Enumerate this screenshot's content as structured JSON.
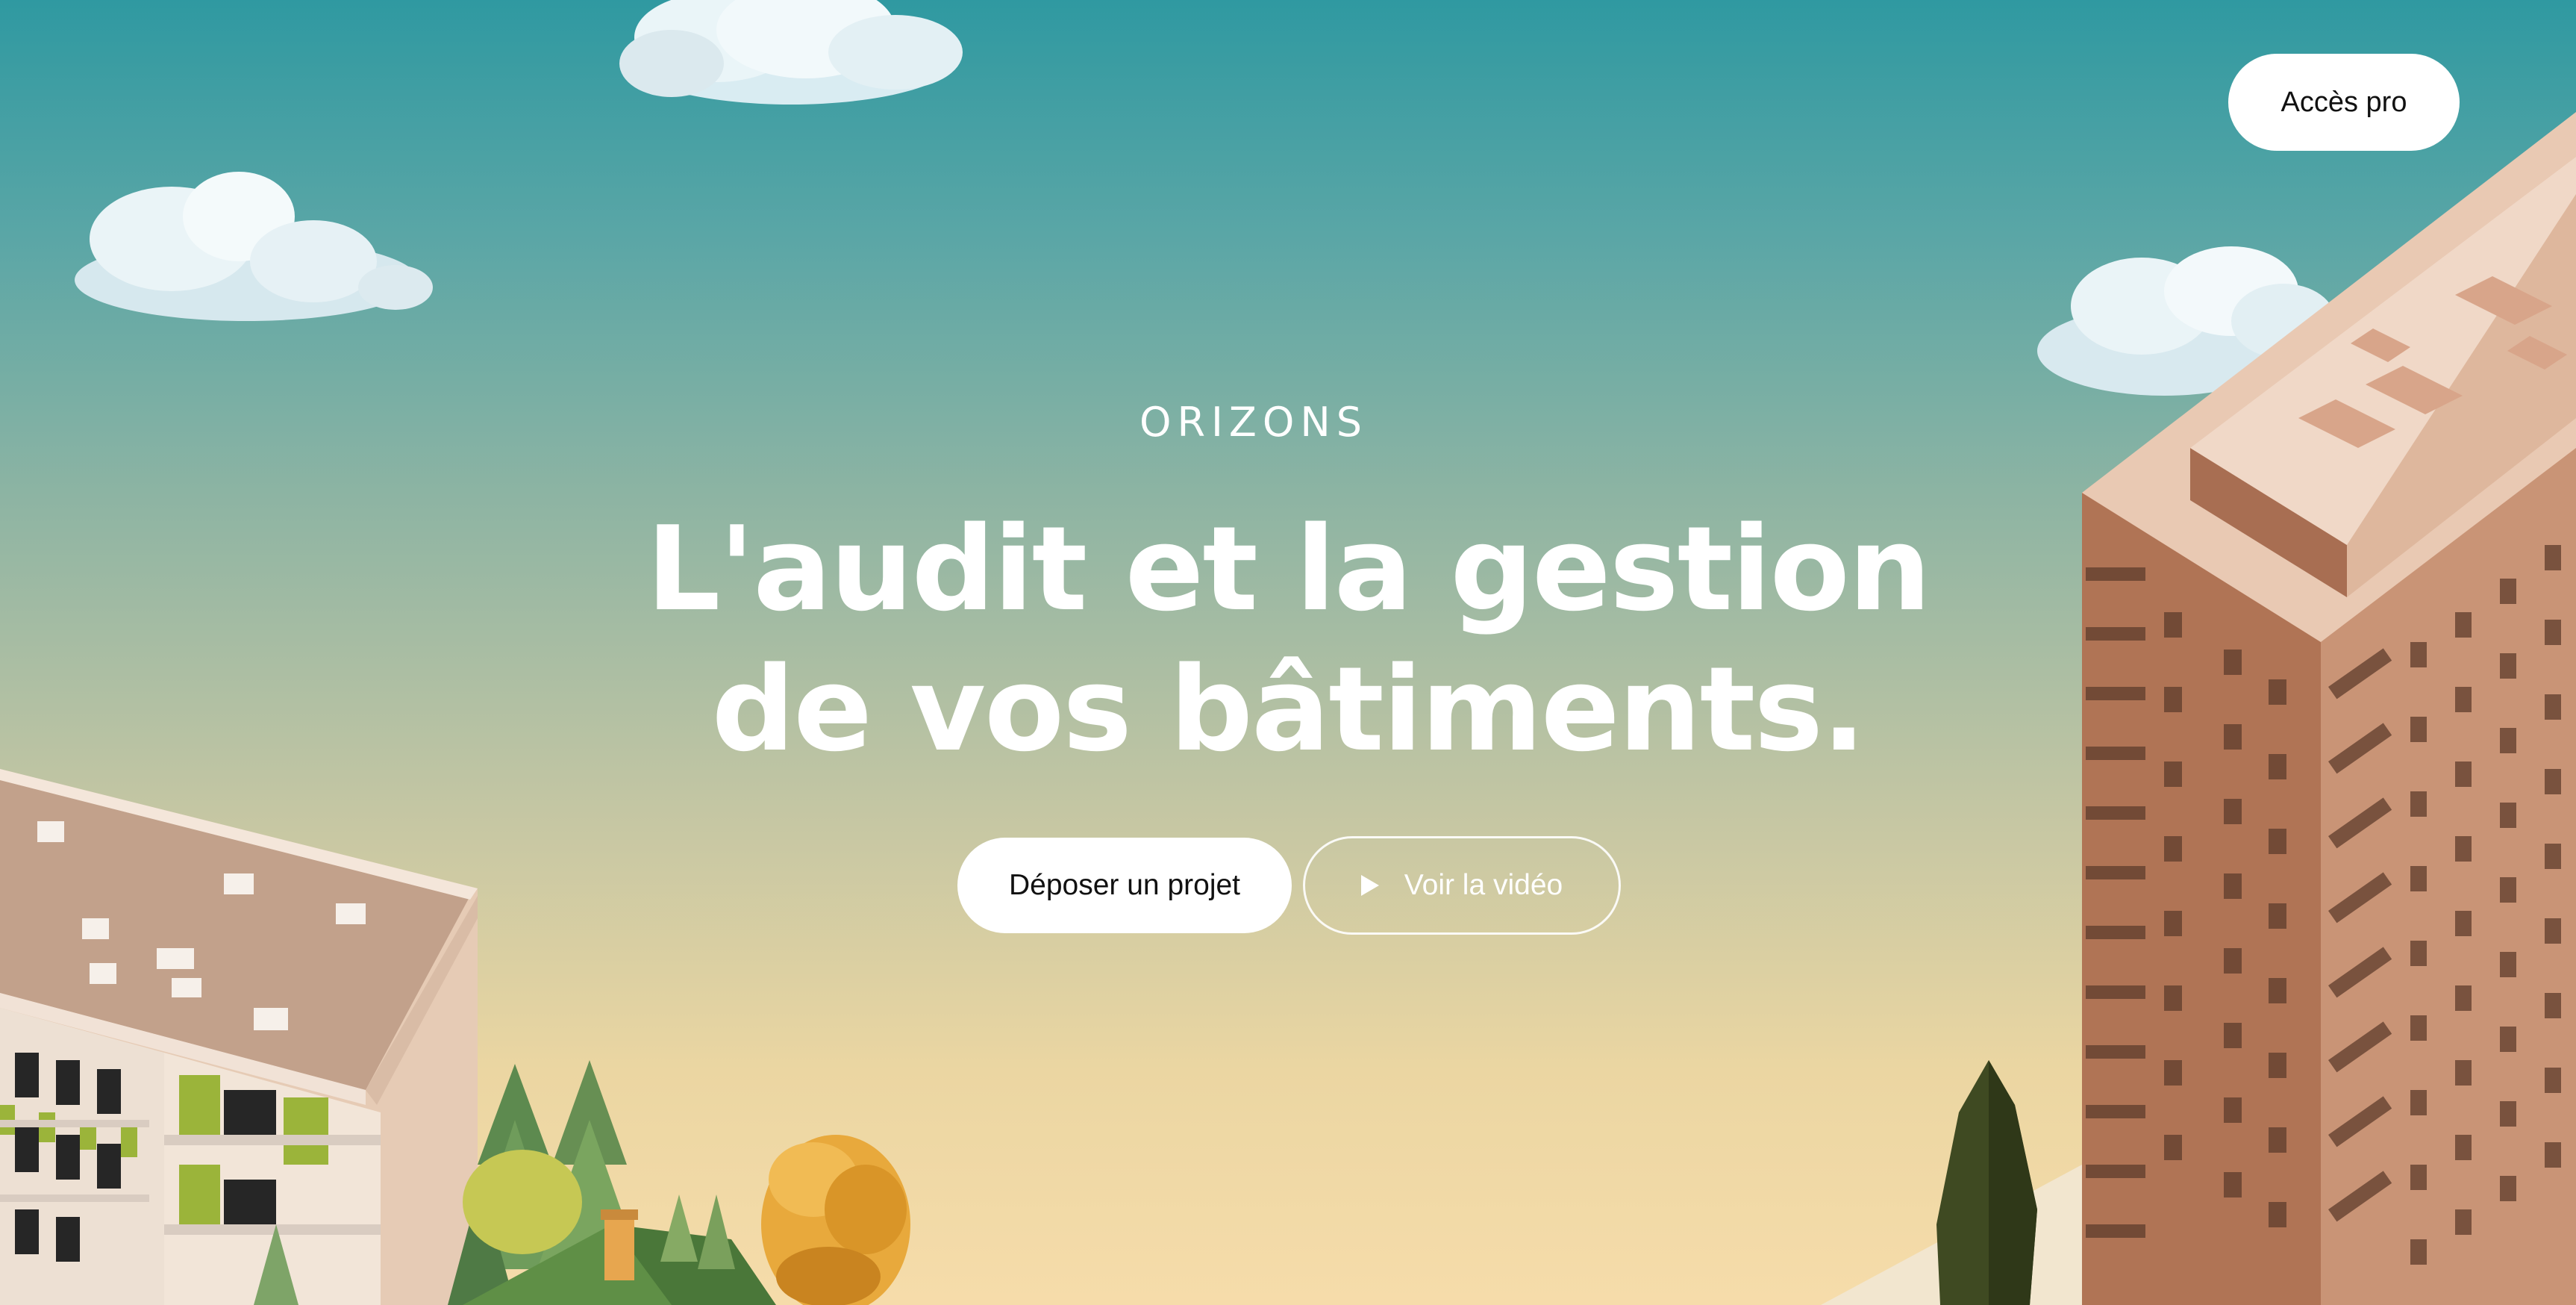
{
  "header": {
    "pro_access_label": "Accès pro"
  },
  "brand": {
    "logo_text": "ORIZONS"
  },
  "hero": {
    "headline_line1": "L'audit et la gestion",
    "headline_line2": "de vos bâtiments.",
    "primary_cta_label": "Déposer un projet",
    "video_cta_label": "Voir la vidéo"
  },
  "icons": {
    "play": "play-icon"
  },
  "colors": {
    "sky_top": "#2f99a1",
    "sky_bottom": "#f6dcaa",
    "button_bg": "#ffffff",
    "text_light": "#ffffff"
  }
}
